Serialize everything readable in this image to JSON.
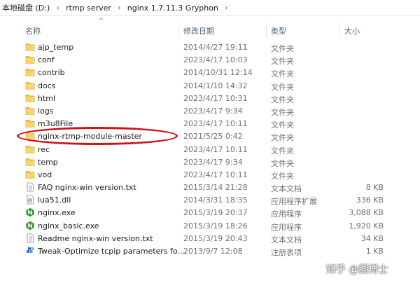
{
  "breadcrumb": {
    "items": [
      "本地磁盘 (D:)",
      "rtmp server",
      "nginx 1.7.11.3 Gryphon"
    ],
    "separator": "›"
  },
  "columns": {
    "name": "名称",
    "date": "修改日期",
    "type": "类型",
    "size": "大小"
  },
  "files": [
    {
      "name": "ajp_temp",
      "date": "2014/4/27 19:11",
      "type": "文件夹",
      "size": "",
      "icon": "folder-icon"
    },
    {
      "name": "conf",
      "date": "2023/4/17 10:03",
      "type": "文件夹",
      "size": "",
      "icon": "folder-icon"
    },
    {
      "name": "contrib",
      "date": "2014/10/31 12:14",
      "type": "文件夹",
      "size": "",
      "icon": "folder-icon"
    },
    {
      "name": "docs",
      "date": "2014/1/10 14:32",
      "type": "文件夹",
      "size": "",
      "icon": "folder-icon"
    },
    {
      "name": "html",
      "date": "2023/4/17 10:31",
      "type": "文件夹",
      "size": "",
      "icon": "folder-icon"
    },
    {
      "name": "logs",
      "date": "2023/4/17 9:34",
      "type": "文件夹",
      "size": "",
      "icon": "folder-icon"
    },
    {
      "name": "m3u8File",
      "date": "2023/4/17 10:11",
      "type": "文件夹",
      "size": "",
      "icon": "folder-icon"
    },
    {
      "name": "nginx-rtmp-module-master",
      "date": "2021/5/25 0:42",
      "type": "文件夹",
      "size": "",
      "icon": "folder-icon"
    },
    {
      "name": "rec",
      "date": "2023/4/17 10:11",
      "type": "文件夹",
      "size": "",
      "icon": "folder-icon"
    },
    {
      "name": "temp",
      "date": "2023/4/17 9:34",
      "type": "文件夹",
      "size": "",
      "icon": "folder-icon"
    },
    {
      "name": "vod",
      "date": "2023/4/17 10:11",
      "type": "文件夹",
      "size": "",
      "icon": "folder-icon"
    },
    {
      "name": "FAQ nginx-win version.txt",
      "date": "2015/3/14 21:28",
      "type": "文本文档",
      "size": "8 KB",
      "icon": "text-file-icon"
    },
    {
      "name": "lua51.dll",
      "date": "2014/3/31 18:35",
      "type": "应用程序扩展",
      "size": "336 KB",
      "icon": "dll-file-icon"
    },
    {
      "name": "nginx.exe",
      "date": "2015/3/19 20:37",
      "type": "应用程序",
      "size": "3,088 KB",
      "icon": "nginx-exe-icon"
    },
    {
      "name": "nginx_basic.exe",
      "date": "2015/3/19 18:26",
      "type": "应用程序",
      "size": "1,920 KB",
      "icon": "nginx-exe-icon"
    },
    {
      "name": "Readme nginx-win version.txt",
      "date": "2015/3/19 20:43",
      "type": "文本文档",
      "size": "34 KB",
      "icon": "text-file-icon"
    },
    {
      "name": "Tweak-Optimize tcpip parameters fo...",
      "date": "2013/9/7 12:08",
      "type": "注册表项",
      "size": "1 KB",
      "icon": "registry-file-icon"
    }
  ],
  "watermark": "知乎 @图博士",
  "colors": {
    "folder": "#f0c24e",
    "highlight": "#c8141a",
    "nginx_green": "#2e9a2e"
  }
}
